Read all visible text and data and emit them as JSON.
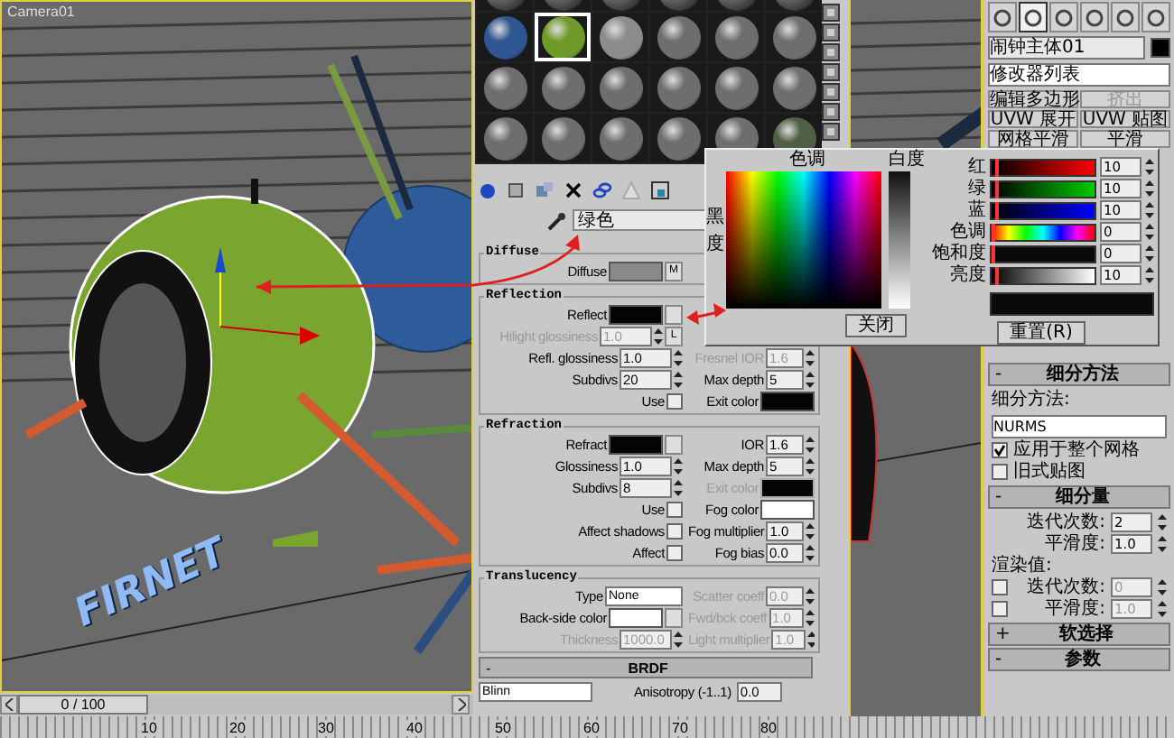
{
  "viewport": {
    "label": "Camera01",
    "scene_text": "FIRNET",
    "time_slider": {
      "label": "0 / 100",
      "level": 0
    }
  },
  "timeline_ticks": [
    "10",
    "20",
    "30",
    "40",
    "50",
    "60",
    "70",
    "80"
  ],
  "material_editor": {
    "slots": [
      {
        "selected": false
      },
      {
        "selected": false
      },
      {
        "selected": false
      },
      {
        "selected": false
      },
      {
        "selected": false
      },
      {
        "selected": false
      },
      {
        "color": "#2e5690",
        "selected": false
      },
      {
        "color": "#6f9a2a",
        "selected": true
      },
      {
        "color": "#8c8c8c",
        "selected": false
      },
      {
        "color": "#6e6e6e",
        "selected": false
      },
      {
        "color": "#6e6e6e",
        "selected": false
      },
      {
        "color": "#6e6e6e",
        "selected": false
      },
      {
        "color": "#6e6e6e",
        "selected": false
      },
      {
        "color": "#6e6e6e",
        "selected": false
      },
      {
        "color": "#6e6e6e",
        "selected": false
      },
      {
        "color": "#6e6e6e",
        "selected": false
      },
      {
        "color": "#6e6e6e",
        "selected": false
      },
      {
        "color": "#6e6e6e",
        "selected": false
      },
      {
        "color": "#6e6e6e",
        "selected": false
      },
      {
        "color": "#6e6e6e",
        "selected": false
      },
      {
        "color": "#6e6e6e",
        "selected": false
      },
      {
        "color": "#6e6e6e",
        "selected": false
      },
      {
        "color": "#6e6e6e",
        "selected": false
      },
      {
        "color": "#4f5e44",
        "selected": false
      }
    ],
    "material_name": "绿色",
    "groups": [
      {
        "title": "Diffuse",
        "rows": [
          {
            "left": {
              "kind": "swatch",
              "label": "Diffuse",
              "color": "#8a8a8a",
              "button": "M"
            }
          }
        ]
      },
      {
        "title": "Reflection",
        "rows": [
          {
            "left": {
              "kind": "swatch",
              "label": "Reflect",
              "color": "#050505",
              "map_button": true
            }
          },
          {
            "left": {
              "kind": "spinner",
              "label": "Hilight glossiness",
              "value": "1.0",
              "disabled": true,
              "button": "L"
            }
          },
          {
            "left": {
              "kind": "spinner",
              "label": "Refl. glossiness",
              "value": "1.0",
              "disabled": false
            },
            "right": {
              "kind": "spinner",
              "label": "Fresnel IOR",
              "value": "1.6",
              "disabled": true
            }
          },
          {
            "left": {
              "kind": "spinner",
              "label": "Subdivs",
              "value": "20",
              "disabled": false
            },
            "right": {
              "kind": "spinner",
              "label": "Max depth",
              "value": "5",
              "disabled": false
            }
          },
          {
            "left": {
              "kind": "check",
              "label": "Use",
              "checked": false
            },
            "right": {
              "kind": "swatch",
              "label": "Exit color",
              "color": "#050505"
            }
          }
        ]
      },
      {
        "title": "Refraction",
        "rows": [
          {
            "left": {
              "kind": "swatch",
              "label": "Refract",
              "color": "#050505",
              "map_button": true
            },
            "right": {
              "kind": "spinner",
              "label": "IOR",
              "value": "1.6",
              "disabled": false
            }
          },
          {
            "left": {
              "kind": "spinner",
              "label": "Glossiness",
              "value": "1.0",
              "disabled": false
            },
            "right": {
              "kind": "spinner",
              "label": "Max depth",
              "value": "5",
              "disabled": false
            }
          },
          {
            "left": {
              "kind": "spinner",
              "label": "Subdivs",
              "value": "8",
              "disabled": false
            },
            "right": {
              "kind": "swatch",
              "label": "Exit color",
              "color": "#050505",
              "disabled": true
            }
          },
          {
            "left": {
              "kind": "check",
              "label": "Use",
              "checked": false
            },
            "right": {
              "kind": "swatch",
              "label": "Fog color",
              "color": "#ffffff"
            }
          },
          {
            "left": {
              "kind": "check",
              "label": "Affect shadows",
              "checked": false
            },
            "right": {
              "kind": "spinner",
              "label": "Fog multiplier",
              "value": "1.0",
              "disabled": false
            }
          },
          {
            "left": {
              "kind": "check",
              "label": "Affect",
              "checked": false
            },
            "right": {
              "kind": "spinner",
              "label": "Fog bias",
              "value": "0.0",
              "disabled": false
            }
          }
        ]
      },
      {
        "title": "Translucency",
        "rows": [
          {
            "left": {
              "kind": "dropdown",
              "label": "Type",
              "value": "None"
            },
            "right": {
              "kind": "spinner",
              "label": "Scatter coeff",
              "value": "0.0",
              "disabled": true
            }
          },
          {
            "left": {
              "kind": "swatch",
              "label": "Back-side color",
              "color": "#ffffff",
              "map_button": true
            },
            "right": {
              "kind": "spinner",
              "label": "Fwd/bck coeff",
              "value": "1.0",
              "disabled": true
            }
          },
          {
            "left": {
              "kind": "spinner",
              "label": "Thickness",
              "value": "1000.0",
              "disabled": true
            },
            "right": {
              "kind": "spinner",
              "label": "Light multiplier",
              "value": "1.0",
              "disabled": true
            }
          }
        ]
      }
    ],
    "brdf": {
      "sign": "-",
      "title": "BRDF",
      "shader": "Blinn",
      "label": "Anisotropy (-1..1)",
      "value": "0.0"
    }
  },
  "color_picker": {
    "hue_label": "色调",
    "whiteness_label": "白度",
    "side_labels": [
      "黑",
      "度"
    ],
    "channels": [
      {
        "kind": "red",
        "label": "红",
        "value": "10",
        "level": 0.04
      },
      {
        "kind": "green",
        "label": "绿",
        "value": "10",
        "level": 0.04
      },
      {
        "kind": "blue",
        "label": "蓝",
        "value": "10",
        "level": 0.04
      },
      {
        "kind": "hue",
        "label": "色调",
        "value": "0",
        "level": 0
      },
      {
        "kind": "saturation",
        "label": "饱和度",
        "value": "0",
        "level": 0
      },
      {
        "kind": "value",
        "label": "亮度",
        "value": "10",
        "level": 0.04
      }
    ],
    "color": "#0a0a0a",
    "close": "关闭",
    "reset": "重置(R)"
  },
  "command_panel": {
    "tabs": [
      {
        "selected": false
      },
      {
        "selected": true
      },
      {
        "selected": false
      },
      {
        "selected": false
      },
      {
        "selected": false
      },
      {
        "selected": false
      }
    ],
    "object_name": "闹钟主体01",
    "modifier_list": "修改器列表",
    "buttons": [
      {
        "label": "编辑多边形",
        "disabled": false
      },
      {
        "label": "挤出",
        "disabled": true
      },
      {
        "label": "UVW 展开",
        "disabled": false
      },
      {
        "label": "UVW 贴图",
        "disabled": false
      },
      {
        "label": "网格平滑",
        "disabled": false
      },
      {
        "label": "平滑",
        "disabled": false
      }
    ],
    "subdivision_method": {
      "sign": "-",
      "title": "细分方法",
      "label": "细分方法:",
      "value": "NURMS",
      "options": [
        {
          "label": "应用于整个网格",
          "checked": true
        },
        {
          "label": "旧式贴图",
          "checked": false
        }
      ]
    },
    "subdivision_amount": {
      "sign": "-",
      "title": "细分量",
      "fields": [
        {
          "label": "迭代次数:",
          "value": "2"
        },
        {
          "label": "平滑度:",
          "value": "1.0"
        }
      ],
      "render_label": "渲染值:",
      "render_fields": [
        {
          "label": "迭代次数:",
          "value": "0",
          "checked": false
        },
        {
          "label": "平滑度:",
          "value": "1.0",
          "checked": false
        }
      ]
    },
    "more_rollouts": [
      {
        "sign": "+",
        "title": "软选择"
      },
      {
        "sign": "-",
        "title": "参数"
      }
    ]
  }
}
